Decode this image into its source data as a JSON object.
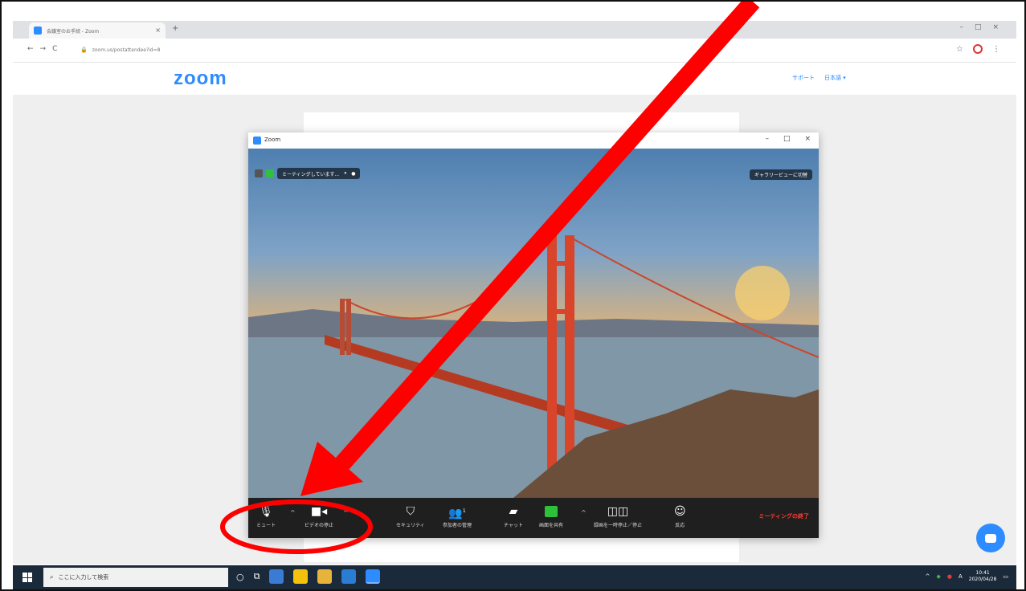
{
  "browser": {
    "tab_title": "会議室のお手続 - Zoom",
    "tab_close": "×",
    "new_tab": "+",
    "window_controls": [
      "–",
      "□",
      "×"
    ],
    "nav_buttons": [
      "←",
      "→",
      "C"
    ],
    "url": "zoom.us/postattendee?id=8",
    "right_icons": [
      "☆",
      "⋮"
    ]
  },
  "page": {
    "logo": "zoom",
    "links": [
      "サポート",
      "日本語 ▾"
    ]
  },
  "zoom_window": {
    "title": "Zoom",
    "controls": [
      "–",
      "□",
      "×"
    ],
    "meeting_pill": "ミーティングしています...",
    "pill_icons": [
      "⏸",
      "●"
    ],
    "gallery_button": "ギャラリービューに切替",
    "toolbar": {
      "mute": "ミュート",
      "video": "ビデオの停止",
      "security": "セキュリティ",
      "participants": "参加者の管理",
      "participants_count": "1",
      "chat": "チャット",
      "share": "画面を共有",
      "breakout": "録画を一時停止／停止",
      "reactions": "反応",
      "end": "ミーティングの終了"
    }
  },
  "taskbar": {
    "search_placeholder": "ここに入力して検索",
    "tray_text": "A",
    "clock_time": "10:41",
    "clock_date": "2020/04/28"
  },
  "colors": {
    "zoom_blue": "#2d8cff",
    "annotation_red": "#ff0000",
    "end_red": "#ff3b30"
  }
}
